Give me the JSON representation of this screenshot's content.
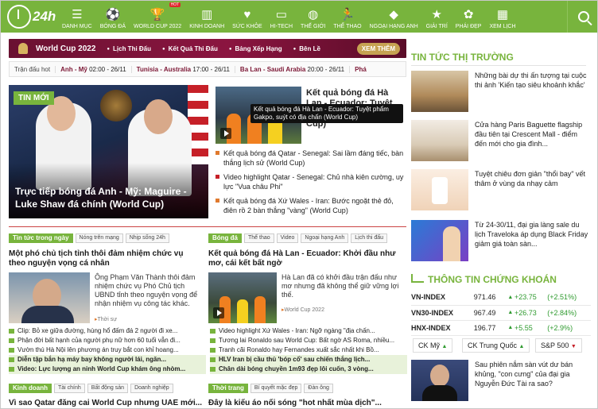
{
  "nav": {
    "logo_text": "24h",
    "items": [
      {
        "label": "DANH MỤC",
        "icon": "menu-icon",
        "glyph": "☰"
      },
      {
        "label": "BÓNG ĐÁ",
        "icon": "soccer-ball-icon",
        "glyph": "⚽"
      },
      {
        "label": "WORLD CUP 2022",
        "icon": "trophy-icon",
        "glyph": "🏆",
        "hot": "HOT"
      },
      {
        "label": "KINH DOANH",
        "icon": "chart-icon",
        "glyph": "▥"
      },
      {
        "label": "SỨC KHỎE",
        "icon": "health-icon",
        "glyph": "♥"
      },
      {
        "label": "HI-TECH",
        "icon": "device-icon",
        "glyph": "▭"
      },
      {
        "label": "THẾ GIỚI",
        "icon": "globe-icon",
        "glyph": "◍"
      },
      {
        "label": "THỂ THAO",
        "icon": "runner-icon",
        "glyph": "🏃"
      },
      {
        "label": "NGOẠI HẠNG ANH",
        "icon": "league-icon",
        "glyph": "◆"
      },
      {
        "label": "GIẢI TRÍ",
        "icon": "entertainment-icon",
        "glyph": "★"
      },
      {
        "label": "PHÁI ĐẸP",
        "icon": "beauty-icon",
        "glyph": "✿"
      },
      {
        "label": "XEM LỊCH",
        "icon": "calendar-icon",
        "glyph": "▦"
      }
    ]
  },
  "worldcup": {
    "title": "World Cup 2022",
    "links": [
      "Lịch Thi Đấu",
      "Kết Quả Thi Đấu",
      "Bảng Xếp Hạng",
      "Bên Lề"
    ],
    "more": "XEM THÊM"
  },
  "ticker": {
    "label": "Trận đấu hot",
    "matches": [
      {
        "teams": "Anh - Mỹ",
        "time": "02:00 - 26/11"
      },
      {
        "teams": "Tunisia - Australia",
        "time": "17:00 - 26/11"
      },
      {
        "teams": "Ba Lan - Saudi Arabia",
        "time": "20:00 - 26/11"
      },
      {
        "teams": "Phá",
        "time": ""
      }
    ]
  },
  "hero": {
    "badge": "TIN MỚI",
    "title": "Trực tiếp bóng đá Anh - Mỹ: Maguire - Luke Shaw đá chính (World Cup)"
  },
  "featured": {
    "title": "Kết quả bóng đá Hà Lan - Ecuador: Tuyệt phẩm Gakpo, (World Cup)",
    "tooltip": "Kết quả bóng đá Hà Lan - Ecuador: Tuyệt phẩm Gakpo, suýt có địa chấn (World Cup)",
    "items": [
      "Kết quả bóng đá Qatar - Senegal: Sai lầm đáng tiếc, bàn thắng lịch sử (World Cup)",
      "Video highlight Qatar - Senegal: Chủ nhà kiên cường, uy lực \"Vua châu Phi\"",
      "Kết quả bóng đá Xứ Wales - Iran: Bước ngoặt thẻ đỏ, điên rồ 2 bàn thắng \"vàng\" (World Cup)"
    ]
  },
  "news_today": {
    "tab": "Tin tức trong ngày",
    "subtabs": [
      "Nóng trên mạng",
      "Nhịp sống 24h"
    ],
    "title": "Một phó chủ tịch tỉnh thôi đảm nhiệm chức vụ theo nguyện vọng cá nhân",
    "desc": "Ông Phạm Văn Thành thôi đảm nhiệm chức vụ Phó Chủ tịch UBND tỉnh theo nguyện vọng để nhận nhiệm vụ công tác khác.",
    "tag": "Thời sự",
    "links": [
      {
        "text": "Clip: Bỏ xe giữa đường, hùng hổ đấm đá 2 người đi xe...",
        "hl": false
      },
      {
        "text": "Phận đời bất hạnh của người phụ nữ hơn 60 tuổi vẫn đi...",
        "hl": false
      },
      {
        "text": "Vườn thú Hà Nội lên phương án truy bắt con khỉ hoang...",
        "hl": false
      },
      {
        "text": "Diễn tập bắn hạ máy bay không người lái, ngăn...",
        "hl": true
      },
      {
        "text": "Video: Lực lượng an ninh World Cup khám ông nhòm...",
        "hl": true
      }
    ]
  },
  "football": {
    "tab": "Bóng đá",
    "subtabs": [
      "Thể thao",
      "Video",
      "Ngoại hạng Anh",
      "Lịch thi đấu"
    ],
    "title": "Kết quả bóng đá Hà Lan - Ecuador: Khởi đầu như mơ, cái kết bất ngờ",
    "desc": "Hà Lan đã có khởi đầu trận đấu như mơ nhưng đã không thể giữ vững lợi thế.",
    "tag": "World Cup 2022",
    "links": [
      {
        "text": "Video highlight Xứ Wales - Iran: Ngỡ ngàng \"địa chấn...",
        "hl": false
      },
      {
        "text": "Tương lai Ronaldo sau World Cup: Bất ngờ AS Roma, nhiều...",
        "hl": false
      },
      {
        "text": "Tranh cãi Ronaldo hay Fernandes xuất sắc nhất khi Bồ...",
        "hl": false
      },
      {
        "text": "HLV Iran bị cầu thủ 'bóp cổ' sau chiến thắng lịch...",
        "hl": true
      },
      {
        "text": "Chân dài bóng chuyền 1m93 đẹp lôi cuốn, 3 vòng...",
        "hl": true
      }
    ]
  },
  "business": {
    "tab": "Kinh doanh",
    "subtabs": [
      "Tài chính",
      "Bất động sản",
      "Doanh nghiệp"
    ],
    "title": "Vì sao Qatar đăng cai World Cup nhưng UAE mới..."
  },
  "fashion": {
    "tab": "Thời trang",
    "subtabs": [
      "Bí quyết mặc đẹp",
      "Đàn ông"
    ],
    "title": "Đây là kiểu áo nổi sóng \"hot nhất mùa dịch\"..."
  },
  "market": {
    "title": "TIN TỨC THỊ TRƯỜNG",
    "items": [
      "Những bài dự thi ấn tượng tại cuộc thi ảnh 'Kiến tạo siêu khoảnh khắc'",
      "Cửa hàng Paris Baguette flagship đầu tiên tại Crescent Mall - điểm đến mới cho gia đình...",
      "Tuyệt chiêu đơn giản \"thổi bay\" vết thâm ở vùng da nhạy cảm",
      "Từ 24-30/11, đại gia làng sale du lịch Traveloka áp dụng Black Friday giảm giá toàn sàn..."
    ]
  },
  "stocks": {
    "title": "THÔNG TIN CHỨNG KHOÁN",
    "rows": [
      {
        "name": "VN-INDEX",
        "value": "971.46",
        "change": "+23.75",
        "pct": "(+2.51%)"
      },
      {
        "name": "VN30-INDEX",
        "value": "967.49",
        "change": "+26.73",
        "pct": "(+2.84%)"
      },
      {
        "name": "HNX-INDEX",
        "value": "196.77",
        "change": "+5.55",
        "pct": "(+2.9%)"
      }
    ],
    "markets": [
      {
        "label": "CK Mỹ",
        "dir": "up"
      },
      {
        "label": "CK Trung Quốc",
        "dir": "up"
      },
      {
        "label": "S&P 500",
        "dir": "down"
      }
    ],
    "last_news": "Sau phiên nắm sàn vút dư bán khủng, \"con cưng\" của đại gia Nguyễn Đức Tài ra sao?"
  }
}
